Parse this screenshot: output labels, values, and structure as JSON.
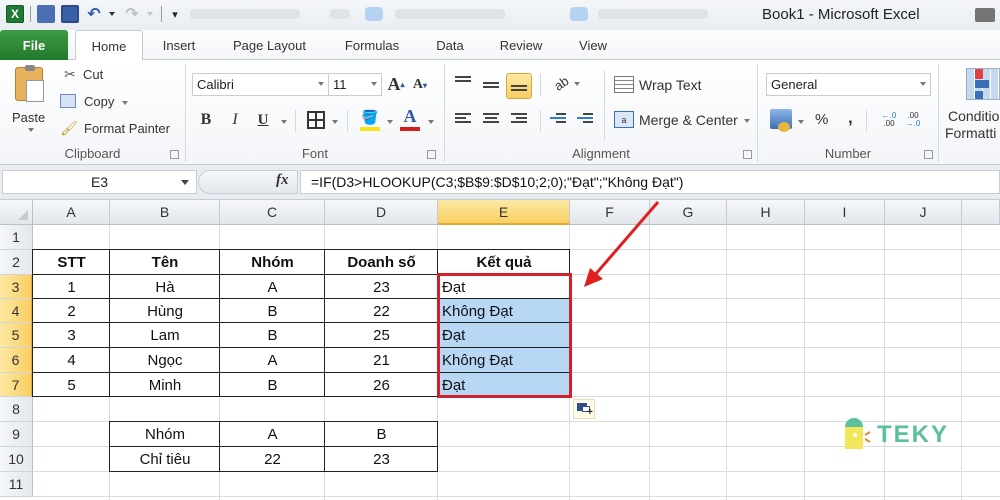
{
  "titlebar": {
    "app_title": "Book1  -  Microsoft Excel",
    "quick_access": [
      "excel-logo",
      "save-as",
      "save",
      "undo",
      "redo",
      "customize"
    ]
  },
  "tabs": [
    {
      "label": "File",
      "active": false
    },
    {
      "label": "Home",
      "active": true
    },
    {
      "label": "Insert",
      "active": false
    },
    {
      "label": "Page Layout",
      "active": false
    },
    {
      "label": "Formulas",
      "active": false
    },
    {
      "label": "Data",
      "active": false
    },
    {
      "label": "Review",
      "active": false
    },
    {
      "label": "View",
      "active": false
    }
  ],
  "ribbon": {
    "clipboard": {
      "label": "Clipboard",
      "paste": "Paste",
      "cut": "Cut",
      "copy": "Copy",
      "format_painter": "Format Painter"
    },
    "font": {
      "label": "Font",
      "font_name": "Calibri",
      "font_size": "11",
      "bold": "B",
      "italic": "I",
      "underline": "U",
      "fill_color": "#f5e616",
      "font_color": "#d01f1f"
    },
    "alignment": {
      "label": "Alignment",
      "wrap_text": "Wrap Text",
      "merge_center": "Merge & Center",
      "active_vertical_align": "bottom"
    },
    "number": {
      "label": "Number",
      "format": "General",
      "percent": "%",
      "comma": ","
    },
    "styles": {
      "conditional_formatting_line1": "Conditio",
      "conditional_formatting_line2": "Formatti"
    }
  },
  "formula_bar": {
    "name_box": "E3",
    "fx": "fx",
    "formula": "=IF(D3>HLOOKUP(C3;$B$9:$D$10;2;0);\"Đạt\";\"Không Đạt\")"
  },
  "sheet": {
    "columns": [
      "A",
      "B",
      "C",
      "D",
      "E",
      "F",
      "G",
      "H",
      "I",
      "J"
    ],
    "selected_column": "E",
    "rows": [
      "1",
      "2",
      "3",
      "4",
      "5",
      "6",
      "7",
      "8",
      "9",
      "10",
      "11"
    ],
    "selected_rows": [
      "3",
      "4",
      "5",
      "6",
      "7"
    ],
    "main_table": {
      "headers": [
        "STT",
        "Tên",
        "Nhóm",
        "Doanh số",
        "Kết quả"
      ],
      "rows": [
        [
          "1",
          "Hà",
          "A",
          "23",
          "Đạt"
        ],
        [
          "2",
          "Hùng",
          "B",
          "22",
          "Không Đạt"
        ],
        [
          "3",
          "Lam",
          "B",
          "25",
          "Đạt"
        ],
        [
          "4",
          "Ngọc",
          "A",
          "21",
          "Không Đạt"
        ],
        [
          "5",
          "Minh",
          "B",
          "26",
          "Đạt"
        ]
      ]
    },
    "lookup_table": {
      "rows": [
        [
          "Nhóm",
          "A",
          "B"
        ],
        [
          "Chỉ tiêu",
          "22",
          "23"
        ]
      ]
    }
  },
  "annotation": {
    "arrow_color": "#e02020",
    "highlight_color": "#d0202a"
  },
  "watermark": {
    "text": "TEKY",
    "color": "#5bbfa0"
  }
}
